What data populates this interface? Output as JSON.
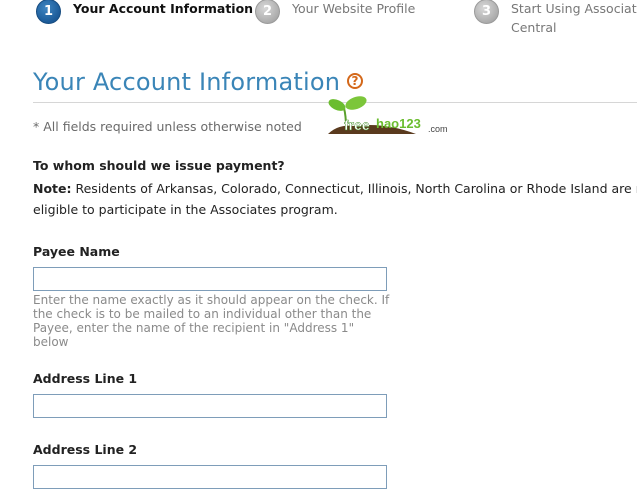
{
  "steps": [
    {
      "number": "1",
      "label": "Your Account Information",
      "state": "active"
    },
    {
      "number": "2",
      "label": "Your Website Profile",
      "state": "inactive"
    },
    {
      "number": "3",
      "label": "Start Using Associates Central",
      "state": "inactive"
    }
  ],
  "heading": {
    "title": "Your Account Information",
    "help_icon": "question-circle-icon",
    "help_glyph": "?"
  },
  "required_note": "* All fields required unless otherwise noted",
  "watermark": {
    "text": "freehao123",
    "suffix": ".com"
  },
  "payment": {
    "question": "To whom should we issue payment?",
    "note_label": "Note:",
    "note_line1": " Residents of Arkansas, Colorado, Connecticut, Illinois, North Carolina or Rhode Island are not",
    "note_line2": "eligible to participate in the Associates program."
  },
  "fields": {
    "payee_name": {
      "label": "Payee Name",
      "value": "",
      "hint": "Enter the name exactly as it should appear on the check. If the check is to be mailed to an individual other than the Payee, enter the name of the recipient in \"Address 1\" below"
    },
    "address_line_1": {
      "label": "Address Line 1",
      "value": ""
    },
    "address_line_2": {
      "label": "Address Line 2",
      "value": ""
    }
  },
  "colors": {
    "title_blue": "#3a85b7",
    "active_step": "#1b5a98",
    "inactive_step": "#a9a9a9",
    "help_orange": "#d4681a",
    "input_border": "#7e9db9"
  }
}
